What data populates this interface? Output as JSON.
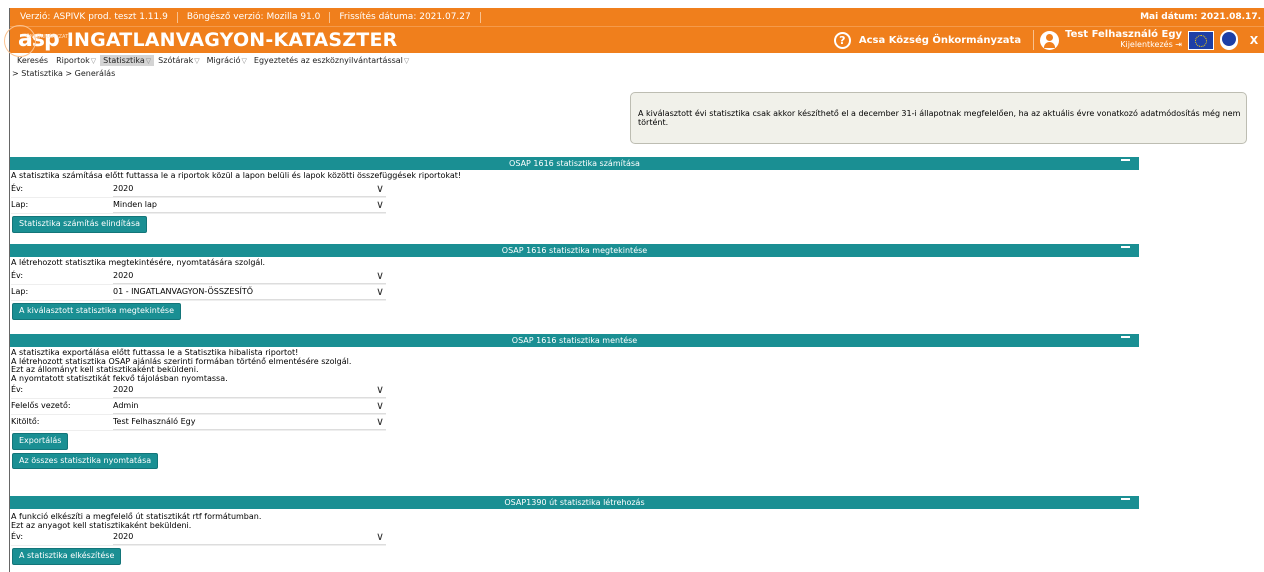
{
  "topbar": {
    "version": "Verzió: ASPIVK prod. teszt 1.11.9",
    "browser": "Böngésző verzió: Mozilla 91.0",
    "updated": "Frissítés dátuma: 2021.07.27",
    "current_date": "Mai dátum: 2021.08.17."
  },
  "header": {
    "logo_small": "ÖNKORMÁNYZATI",
    "logo": "asp",
    "title": "INGATLANVAGYON-KATASZTER",
    "help": "?",
    "org": "Acsa Község Önkormányzata",
    "user": "Test Felhasználó Egy",
    "logout": "Kijelentkezés",
    "close": "X"
  },
  "menu": {
    "items": [
      {
        "label": "Keresés",
        "chev": ""
      },
      {
        "label": "Riportok",
        "chev": "▽"
      },
      {
        "label": "Statisztika",
        "chev": "▽"
      },
      {
        "label": "Szótárak",
        "chev": "▽"
      },
      {
        "label": "Migráció",
        "chev": "▽"
      },
      {
        "label": "Egyeztetés az eszköznyilvántartással",
        "chev": "▽"
      }
    ]
  },
  "breadcrumb": "> Statisztika > Generálás",
  "notice": "A kiválasztott évi statisztika csak akkor készíthető el a december 31-i állapotnak megfelelően, ha az aktuális évre vonatkozó adatmódosítás még nem történt.",
  "sections": [
    {
      "title": "OSAP 1616 statisztika számítása",
      "desc": [
        "A statisztika számítása előtt futtassa le a riportok közül a lapon belüli és lapok közötti összefüggések riportokat!"
      ],
      "fields": [
        {
          "label": "Év:",
          "value": "2020"
        },
        {
          "label": "Lap:",
          "value": "Minden lap"
        }
      ],
      "buttons": [
        "Statisztika számítás elindítása"
      ]
    },
    {
      "title": "OSAP 1616 statisztika megtekintése",
      "desc": [
        "A létrehozott statisztika megtekintésére, nyomtatására szolgál."
      ],
      "fields": [
        {
          "label": "Év:",
          "value": "2020"
        },
        {
          "label": "Lap:",
          "value": "01 - INGATLANVAGYON-ÖSSZESÍTŐ"
        }
      ],
      "buttons": [
        "A kiválasztott statisztika megtekintése"
      ]
    },
    {
      "title": "OSAP 1616 statisztika mentése",
      "desc": [
        "A statisztika exportálása előtt futtassa le a Statisztika hibalista riportot!",
        "A létrehozott statisztika OSAP ajánlás szerinti formában történő elmentésére szolgál.",
        "Ezt az állományt kell statisztikaként beküldeni.",
        "A nyomtatott statisztikát fekvő tájolásban nyomtassa."
      ],
      "fields": [
        {
          "label": "Év:",
          "value": "2020"
        },
        {
          "label": "Felelős vezető:",
          "value": "Admin"
        },
        {
          "label": "Kitöltő:",
          "value": "Test Felhasználó Egy"
        }
      ],
      "buttons": [
        "Exportálás",
        "Az összes statisztika nyomtatása"
      ]
    },
    {
      "title": "OSAP1390 út statisztika létrehozás",
      "desc": [
        "A funkció elkészíti a megfelelő út statisztikát rtf formátumban.",
        "Ezt az anyagot kell statisztikaként beküldeni."
      ],
      "fields": [
        {
          "label": "Év:",
          "value": "2020"
        }
      ],
      "buttons": [
        "A statisztika elkészítése"
      ]
    }
  ],
  "colors": {
    "orange": "#f07f1c",
    "teal": "#1a8f93"
  }
}
